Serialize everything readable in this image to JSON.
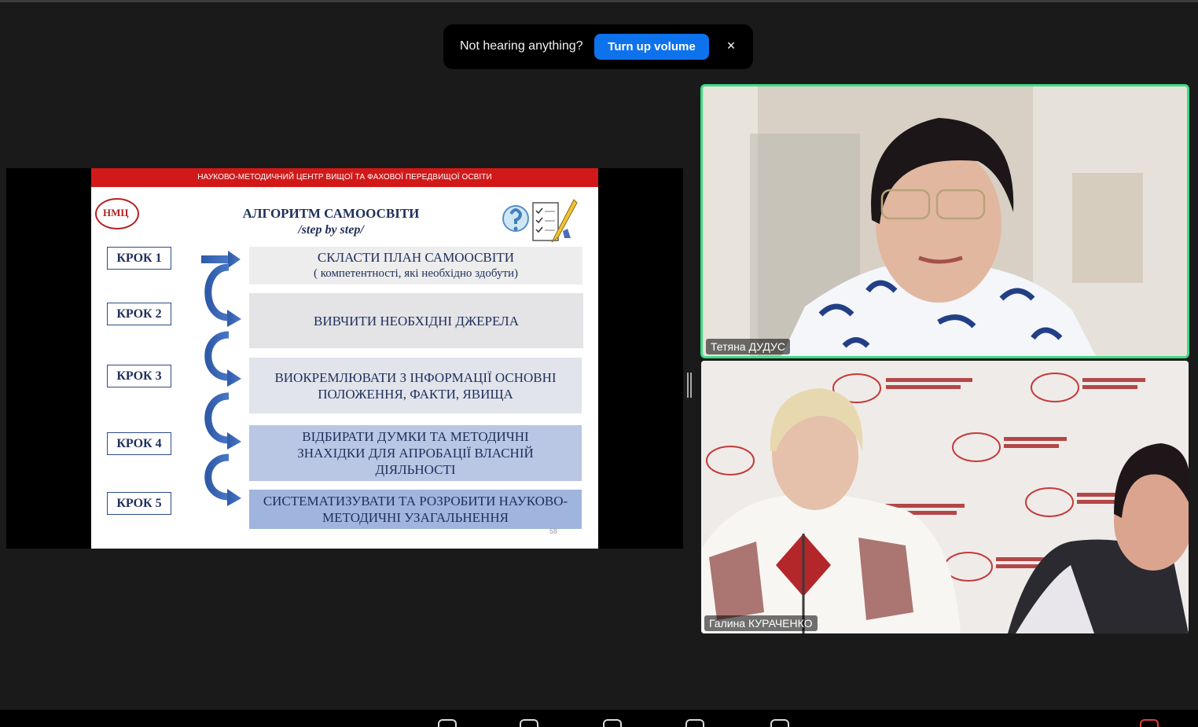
{
  "toast": {
    "message": "Not hearing anything?",
    "button_label": "Turn up volume",
    "close_glyph": "×"
  },
  "slide": {
    "header": "НАУКОВО-МЕТОДИЧНИЙ ЦЕНТР ВИЩОЇ ТА ФАХОВОЇ ПЕРЕДВИЩОЇ ОСВІТИ",
    "logo_text": "НМЦ",
    "title": "АЛГОРИТМ САМООСВІТИ",
    "subtitle": "/step by step/",
    "steps": [
      {
        "label": "КРОК 1",
        "text": "СКЛАСТИ ПЛАН САМООСВІТИ",
        "subtext": "( компетентності, які необхідно здобути)"
      },
      {
        "label": "КРОК 2",
        "text": "ВИВЧИТИ НЕОБХІДНІ ДЖЕРЕЛА"
      },
      {
        "label": "КРОК 3",
        "text": "ВИОКРЕМЛЮВАТИ З  ІНФОРМАЦІЇ ОСНОВНІ ПОЛОЖЕННЯ, ФАКТИ, ЯВИЩА"
      },
      {
        "label": "КРОК 4",
        "text": "ВІДБИРАТИ  ДУМКИ ТА МЕТОДИЧНІ ЗНАХІДКИ ДЛЯ АПРОБАЦІЇ ВЛАСНІЙ ДІЯЛЬНОСТІ"
      },
      {
        "label": "КРОК 5",
        "text": "СИСТЕМАТИЗУВАТИ ТА РОЗРОБИТИ НАУКОВО-МЕТОДИЧНІ УЗАГАЛЬНЕННЯ"
      }
    ],
    "page_number": "58"
  },
  "participants": [
    {
      "name": "Тетяна ДУДУС",
      "active_speaker": true
    },
    {
      "name": "Галина КУРАЧЕНКО",
      "active_speaker": false
    }
  ],
  "backdrop_text": "НАУКОВО-МЕТОДИЧНИЙ ЦЕНТР ВИЩОЇ ТА ФАХОВОЇ ПЕРЕДВИЩОЇ ОСВІТИ",
  "colors": {
    "accent_blue": "#0e72ed",
    "speaker_border": "#3ddc84",
    "slide_header_red": "#d21919",
    "step_gray": "#e4e3e6",
    "step_blue_light": "#d6dce8",
    "step_blue": "#b4c3e4",
    "step_blue_dark": "#9bb2dd"
  }
}
